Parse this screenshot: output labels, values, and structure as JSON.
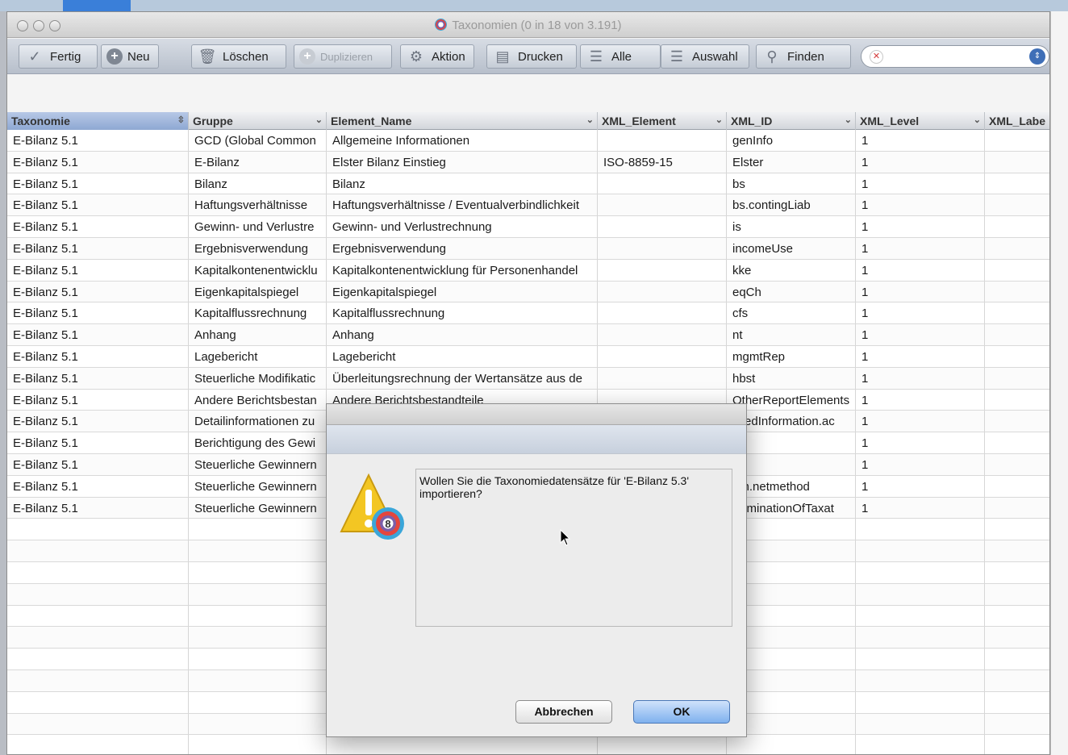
{
  "window": {
    "title": "Taxonomien (0 in 18 von 3.191)"
  },
  "toolbar": {
    "fertig": "Fertig",
    "neu": "Neu",
    "loeschen": "Löschen",
    "duplizieren": "Duplizieren",
    "aktion": "Aktion",
    "drucken": "Drucken",
    "alle": "Alle",
    "auswahl": "Auswahl",
    "finden": "Finden",
    "search_value": ""
  },
  "table": {
    "columns": [
      "Taxonomie",
      "Gruppe",
      "Element_Name",
      "XML_Element",
      "XML_ID",
      "XML_Level",
      "XML_Labe"
    ],
    "rows": [
      [
        "E-Bilanz 5.1",
        "GCD (Global Common",
        "Allgemeine Informationen",
        "",
        "genInfo",
        "1",
        ""
      ],
      [
        "E-Bilanz 5.1",
        "E-Bilanz",
        "Elster Bilanz Einstieg",
        "ISO-8859-15",
        "Elster",
        "1",
        ""
      ],
      [
        "E-Bilanz 5.1",
        "Bilanz",
        "Bilanz",
        "",
        "bs",
        "1",
        ""
      ],
      [
        "E-Bilanz 5.1",
        "Haftungsverhältnisse",
        "Haftungsverhältnisse / Eventualverbindlichkeit",
        "",
        "bs.contingLiab",
        "1",
        ""
      ],
      [
        "E-Bilanz 5.1",
        "Gewinn- und Verlustre",
        "Gewinn- und Verlustrechnung",
        "",
        "is",
        "1",
        ""
      ],
      [
        "E-Bilanz 5.1",
        "Ergebnisverwendung",
        "Ergebnisverwendung",
        "",
        "incomeUse",
        "1",
        ""
      ],
      [
        "E-Bilanz 5.1",
        "Kapitalkontenentwicklu",
        "Kapitalkontenentwicklung für Personenhandel",
        "",
        "kke",
        "1",
        ""
      ],
      [
        "E-Bilanz 5.1",
        "Eigenkapitalspiegel",
        "Eigenkapitalspiegel",
        "",
        "eqCh",
        "1",
        ""
      ],
      [
        "E-Bilanz 5.1",
        "Kapitalflussrechnung",
        "Kapitalflussrechnung",
        "",
        "cfs",
        "1",
        ""
      ],
      [
        "E-Bilanz 5.1",
        "Anhang",
        "Anhang",
        "",
        "nt",
        "1",
        ""
      ],
      [
        "E-Bilanz 5.1",
        "Lagebericht",
        "Lagebericht",
        "",
        "mgmtRep",
        "1",
        ""
      ],
      [
        "E-Bilanz 5.1",
        "Steuerliche Modifikatic",
        "Überleitungsrechnung der Wertansätze aus de",
        "",
        "hbst",
        "1",
        ""
      ],
      [
        "E-Bilanz 5.1",
        "Andere Berichtsbestan",
        "Andere Berichtsbestandteile",
        "",
        "OtherReportElements",
        "1",
        ""
      ],
      [
        "E-Bilanz 5.1",
        "Detailinformationen zu",
        "",
        "",
        "ailedInformation.ac",
        "1",
        ""
      ],
      [
        "E-Bilanz 5.1",
        "Berichtigung des Gewi",
        "",
        "",
        "",
        "1",
        ""
      ],
      [
        "E-Bilanz 5.1",
        "Steuerliche Gewinnern",
        "",
        "",
        "",
        "1",
        ""
      ],
      [
        "E-Bilanz 5.1",
        "Steuerliche Gewinnern",
        "",
        "",
        "gm.netmethod",
        "1",
        ""
      ],
      [
        "E-Bilanz 5.1",
        "Steuerliche Gewinnern",
        "",
        "",
        "terminationOfTaxat",
        "1",
        ""
      ]
    ]
  },
  "dialog": {
    "message": "Wollen Sie die Taxonomiedatensätze für 'E-Bilanz 5.3' importieren?",
    "cancel": "Abbrechen",
    "ok": "OK"
  }
}
